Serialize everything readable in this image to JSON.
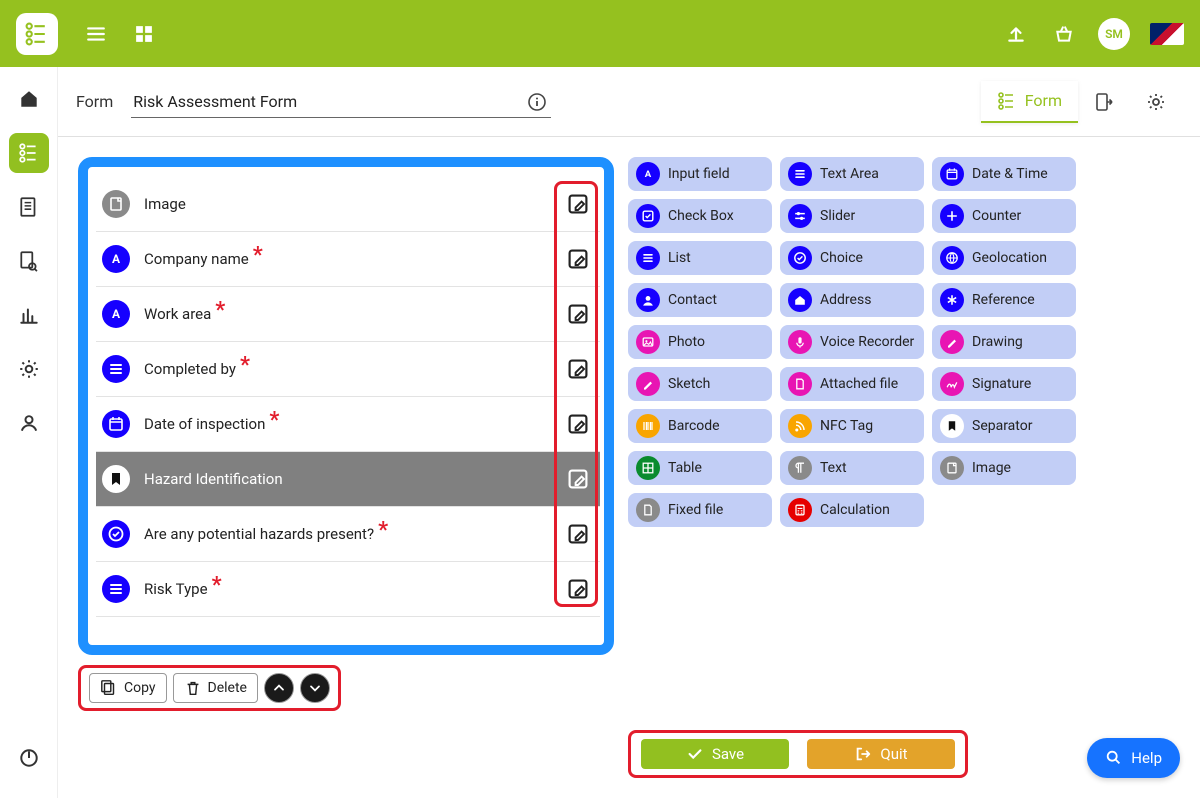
{
  "header": {
    "avatar_initials": "SM"
  },
  "sub_header": {
    "label": "Form",
    "title": "Risk Assessment Form",
    "tabs": {
      "form": "Form"
    }
  },
  "fields": [
    {
      "label": "Image",
      "icon": "page-icon",
      "color": "ic-grey",
      "required": false,
      "selected": false
    },
    {
      "label": "Company name",
      "icon": "letter-a-icon",
      "color": "ic-blue",
      "required": true,
      "selected": false
    },
    {
      "label": "Work area",
      "icon": "letter-a-icon",
      "color": "ic-blue",
      "required": true,
      "selected": false
    },
    {
      "label": "Completed by",
      "icon": "list-icon",
      "color": "ic-blue",
      "required": true,
      "selected": false
    },
    {
      "label": "Date of inspection",
      "icon": "calendar-icon",
      "color": "ic-blue",
      "required": true,
      "selected": false
    },
    {
      "label": "Hazard Identification",
      "icon": "bookmark-icon",
      "color": "ic-white",
      "required": false,
      "selected": true
    },
    {
      "label": "Are any potential hazards present?",
      "icon": "check-circle-icon",
      "color": "ic-blue",
      "required": true,
      "selected": false
    },
    {
      "label": "Risk Type",
      "icon": "list-icon",
      "color": "ic-blue",
      "required": true,
      "selected": false
    }
  ],
  "builder_footer": {
    "copy": "Copy",
    "delete": "Delete"
  },
  "palette": [
    {
      "label": "Input field",
      "icon": "letter-a-icon",
      "color": "tc-blue"
    },
    {
      "label": "Text Area",
      "icon": "list-icon",
      "color": "tc-blue"
    },
    {
      "label": "Date & Time",
      "icon": "calendar-icon",
      "color": "tc-blue"
    },
    {
      "label": "Check Box",
      "icon": "checkbox-icon",
      "color": "tc-blue"
    },
    {
      "label": "Slider",
      "icon": "slider-icon",
      "color": "tc-blue"
    },
    {
      "label": "Counter",
      "icon": "counter-icon",
      "color": "tc-blue"
    },
    {
      "label": "List",
      "icon": "list-icon",
      "color": "tc-blue"
    },
    {
      "label": "Choice",
      "icon": "check-circle-icon",
      "color": "tc-blue"
    },
    {
      "label": "Geolocation",
      "icon": "globe-icon",
      "color": "tc-blue"
    },
    {
      "label": "Contact",
      "icon": "person-icon",
      "color": "tc-blue"
    },
    {
      "label": "Address",
      "icon": "home-icon",
      "color": "tc-blue"
    },
    {
      "label": "Reference",
      "icon": "asterisk-icon",
      "color": "tc-blue"
    },
    {
      "label": "Photo",
      "icon": "photo-icon",
      "color": "tc-magenta"
    },
    {
      "label": "Voice Recorder",
      "icon": "mic-icon",
      "color": "tc-magenta"
    },
    {
      "label": "Drawing",
      "icon": "pen-icon",
      "color": "tc-magenta"
    },
    {
      "label": "Sketch",
      "icon": "pen-icon",
      "color": "tc-magenta"
    },
    {
      "label": "Attached file",
      "icon": "file-icon",
      "color": "tc-magenta"
    },
    {
      "label": "Signature",
      "icon": "sig-icon",
      "color": "tc-magenta"
    },
    {
      "label": "Barcode",
      "icon": "barcode-icon",
      "color": "tc-orange"
    },
    {
      "label": "NFC Tag",
      "icon": "rss-icon",
      "color": "tc-orange"
    },
    {
      "label": "Separator",
      "icon": "bookmark-icon",
      "color": "tc-white"
    },
    {
      "label": "Table",
      "icon": "grid-icon",
      "color": "tc-green"
    },
    {
      "label": "Text",
      "icon": "paragraph-icon",
      "color": "tc-grey"
    },
    {
      "label": "Image",
      "icon": "page-icon",
      "color": "tc-grey"
    },
    {
      "label": "Fixed file",
      "icon": "file-icon",
      "color": "tc-grey"
    },
    {
      "label": "Calculation",
      "icon": "calc-icon",
      "color": "tc-red"
    }
  ],
  "actions": {
    "save": "Save",
    "quit": "Quit"
  },
  "help": {
    "label": "Help"
  }
}
